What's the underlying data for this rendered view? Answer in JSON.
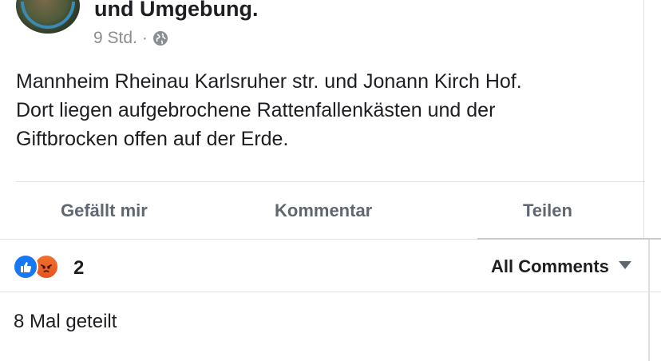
{
  "post": {
    "page_name": "und Umgebung.",
    "time": "9 Std.",
    "separator": "·",
    "privacy_icon": "globe-icon",
    "text_lines": [
      "Mannheim Rheinau Karlsruher str. und Jonann Kirch Hof.",
      "Dort liegen aufgebrochene Rattenfallenkästen und der",
      "Giftbrocken offen auf der Erde."
    ]
  },
  "actions": {
    "like": "Gefällt mir",
    "comment": "Kommentar",
    "share": "Teilen"
  },
  "reactions": {
    "icons": [
      "like-reaction-icon",
      "angry-reaction-icon"
    ],
    "count": "2"
  },
  "comments_filter": {
    "label": "All Comments",
    "icon": "caret-down-icon"
  },
  "shares": {
    "label": "8 Mal geteilt"
  },
  "colors": {
    "like_blue": "#1877f2",
    "angry_orange": "#e8541f",
    "muted_text": "#606770",
    "meta_text": "#8a8d91"
  }
}
